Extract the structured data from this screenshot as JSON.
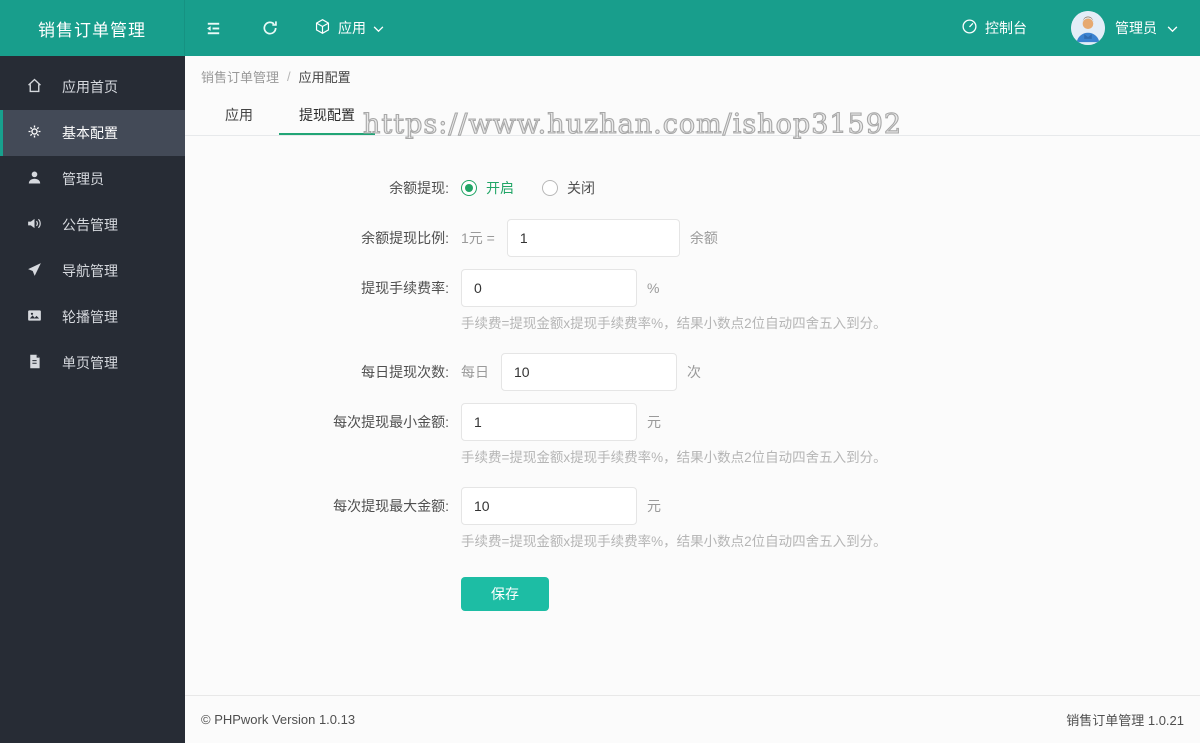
{
  "header": {
    "app_title": "销售订单管理",
    "app_menu_label": "应用",
    "console_label": "控制台",
    "user_label": "管理员"
  },
  "sidebar": {
    "items": [
      {
        "label": "应用首页",
        "icon": "home-icon",
        "active": false
      },
      {
        "label": "基本配置",
        "icon": "gear-icon",
        "active": true
      },
      {
        "label": "管理员",
        "icon": "user-icon",
        "active": false
      },
      {
        "label": "公告管理",
        "icon": "announcement-icon",
        "active": false
      },
      {
        "label": "导航管理",
        "icon": "navigation-icon",
        "active": false
      },
      {
        "label": "轮播管理",
        "icon": "carousel-icon",
        "active": false
      },
      {
        "label": "单页管理",
        "icon": "page-icon",
        "active": false
      }
    ]
  },
  "breadcrumb": {
    "parent": "销售订单管理",
    "separator": "/",
    "current": "应用配置"
  },
  "watermark": "https://www.huzhan.com/ishop31592",
  "tabs": [
    {
      "label": "应用",
      "active": false
    },
    {
      "label": "提现配置",
      "active": true
    }
  ],
  "form": {
    "fields": [
      {
        "label": "余额提现:",
        "type": "radio",
        "options": [
          {
            "label": "开启",
            "checked": true
          },
          {
            "label": "关闭",
            "checked": false
          }
        ]
      },
      {
        "label": "余额提现比例:",
        "prefix": "1元 =",
        "value": "1",
        "suffix": "余额"
      },
      {
        "label": "提现手续费率:",
        "value": "0",
        "suffix": "%",
        "help": "手续费=提现金额x提现手续费率%，结果小数点2位自动四舍五入到分。"
      },
      {
        "label": "每日提现次数:",
        "prefix": "每日",
        "value": "10",
        "suffix": "次"
      },
      {
        "label": "每次提现最小金额:",
        "value": "1",
        "suffix": "元",
        "help": "手续费=提现金额x提现手续费率%，结果小数点2位自动四舍五入到分。"
      },
      {
        "label": "每次提现最大金额:",
        "value": "10",
        "suffix": "元",
        "help": "手续费=提现金额x提现手续费率%，结果小数点2位自动四舍五入到分。"
      }
    ],
    "save_label": "保存"
  },
  "footer": {
    "left": "© PHPwork Version 1.0.13",
    "right": "销售订单管理 1.0.21"
  },
  "colors": {
    "header_teal": "#189e8c",
    "sidebar_dark": "#272c35",
    "sidebar_active": "#434a57",
    "accent_green": "#21a566",
    "tab_underline": "#21a576",
    "save_button": "#1dbda4"
  }
}
